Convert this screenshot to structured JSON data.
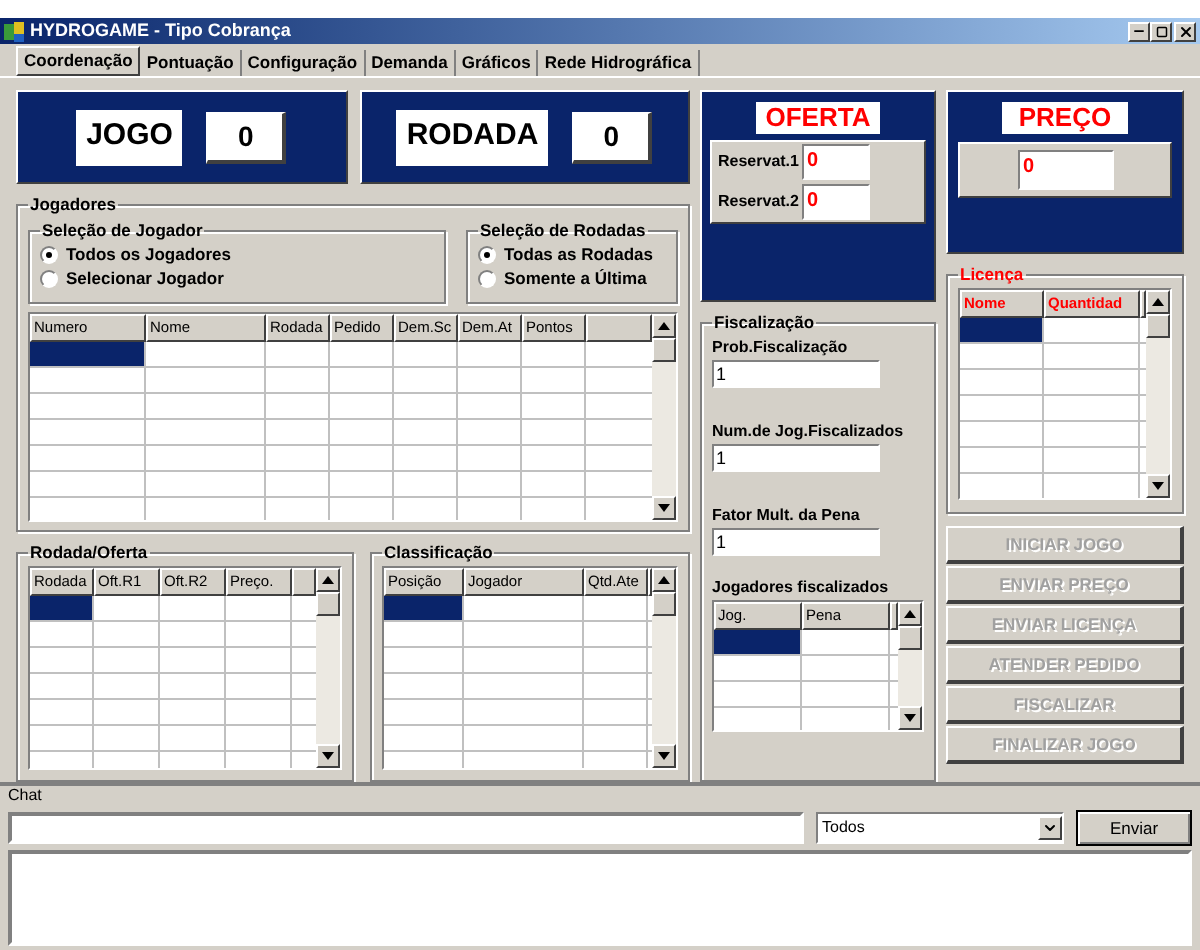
{
  "window": {
    "title": "HYDROGAME - Tipo Cobrança"
  },
  "tabs": [
    {
      "label": "Coordenação",
      "selected": true
    },
    {
      "label": "Pontuação",
      "selected": false
    },
    {
      "label": "Configuração",
      "selected": false
    },
    {
      "label": "Demanda",
      "selected": false
    },
    {
      "label": "Gráficos",
      "selected": false
    },
    {
      "label": "Rede Hidrográfica",
      "selected": false
    }
  ],
  "jogo": {
    "label": "JOGO",
    "value": "0"
  },
  "rodada": {
    "label": "RODADA",
    "value": "0"
  },
  "jogadores": {
    "title": "Jogadores",
    "selecao_jogador": {
      "title": "Seleção de Jogador",
      "options": [
        {
          "label": "Todos os Jogadores",
          "selected": true
        },
        {
          "label": "Selecionar Jogador",
          "selected": false
        }
      ]
    },
    "selecao_rodadas": {
      "title": "Seleção de Rodadas",
      "options": [
        {
          "label": "Todas as Rodadas",
          "selected": true
        },
        {
          "label": "Somente a Última",
          "selected": false
        }
      ]
    },
    "table": {
      "columns": [
        "Numero",
        "Nome",
        "Rodada",
        "Pedido",
        "Dem.Sc",
        "Dem.At",
        "Pontos"
      ],
      "current_cell_highlighted": true
    }
  },
  "rodada_oferta": {
    "title": "Rodada/Oferta",
    "table": {
      "columns": [
        "Rodada",
        "Oft.R1",
        "Oft.R2",
        "Preço."
      ],
      "current_cell_highlighted": true
    }
  },
  "classificacao": {
    "title": "Classificação",
    "table": {
      "columns": [
        "Posição",
        "Jogador",
        "Qtd.Ate"
      ],
      "current_cell_highlighted": true
    }
  },
  "oferta": {
    "title": "OFERTA",
    "fields": [
      {
        "label": "Reservat.1",
        "value": "0"
      },
      {
        "label": "Reservat.2",
        "value": "0"
      }
    ]
  },
  "fiscalizacao": {
    "title": "Fiscalização",
    "fields": [
      {
        "label": "Prob.Fiscalização",
        "value": "1"
      },
      {
        "label": "Num.de Jog.Fiscalizados",
        "value": "1"
      },
      {
        "label": "Fator Mult. da Pena",
        "value": "1"
      }
    ],
    "fiscalizados": {
      "title": "Jogadores fiscalizados",
      "table": {
        "columns": [
          "Jog.",
          "Pena"
        ],
        "current_cell_highlighted": true
      }
    }
  },
  "preco": {
    "title": "PREÇO",
    "value": "0"
  },
  "licenca": {
    "title": "Licença",
    "table": {
      "columns": [
        "Nome",
        "Quantidad"
      ],
      "current_cell_highlighted": true
    }
  },
  "buttons": [
    {
      "label": "INICIAR JOGO",
      "disabled": true
    },
    {
      "label": "ENVIAR PREÇO",
      "disabled": true
    },
    {
      "label": "ENVIAR LICENÇA",
      "disabled": true
    },
    {
      "label": "ATENDER PEDIDO",
      "disabled": true
    },
    {
      "label": "FISCALIZAR",
      "disabled": true
    },
    {
      "label": "FINALIZAR JOGO",
      "disabled": true
    }
  ],
  "chat": {
    "label": "Chat",
    "recipient": "Todos",
    "send_button": "Enviar"
  }
}
